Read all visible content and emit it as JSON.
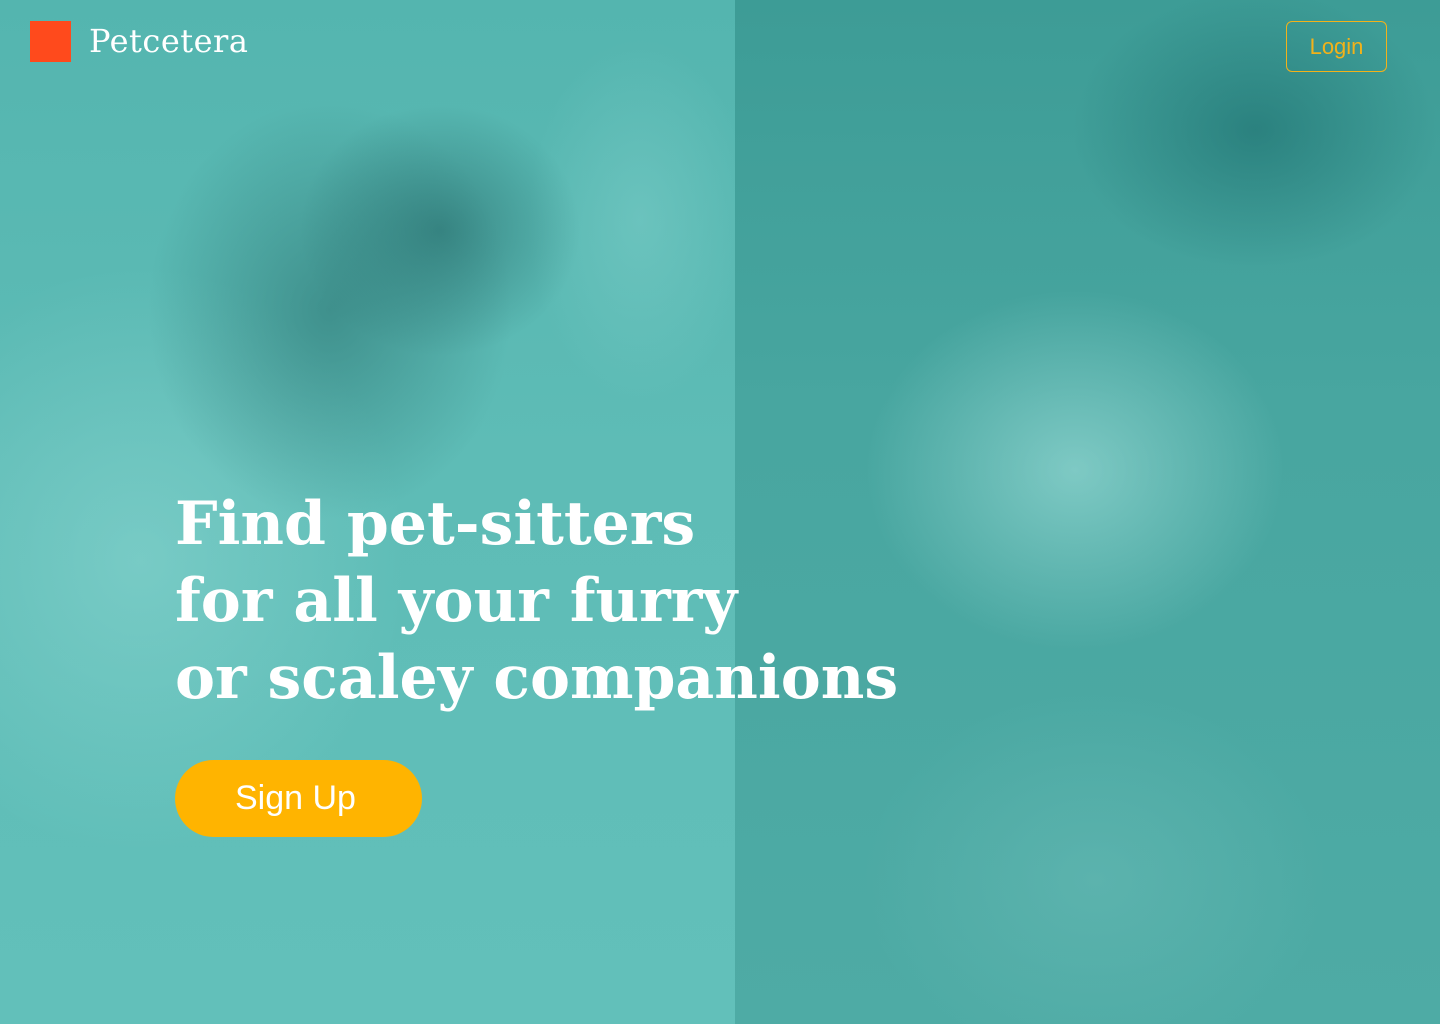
{
  "brand": {
    "name": "Petcetera",
    "mark_color": "#ff4a1c"
  },
  "header": {
    "login_label": "Login"
  },
  "hero": {
    "lines": [
      "Find pet-sitters",
      "for all your furry",
      "or scaley companions"
    ],
    "signup_label": "Sign Up"
  },
  "background": {
    "left_photo": "puppy-photo",
    "right_photo": "hamster-photo",
    "overlay_color": "#4fb3ad"
  },
  "colors": {
    "accent": "#ffb400",
    "login_outline": "#f2b21a",
    "text": "#ffffff"
  }
}
